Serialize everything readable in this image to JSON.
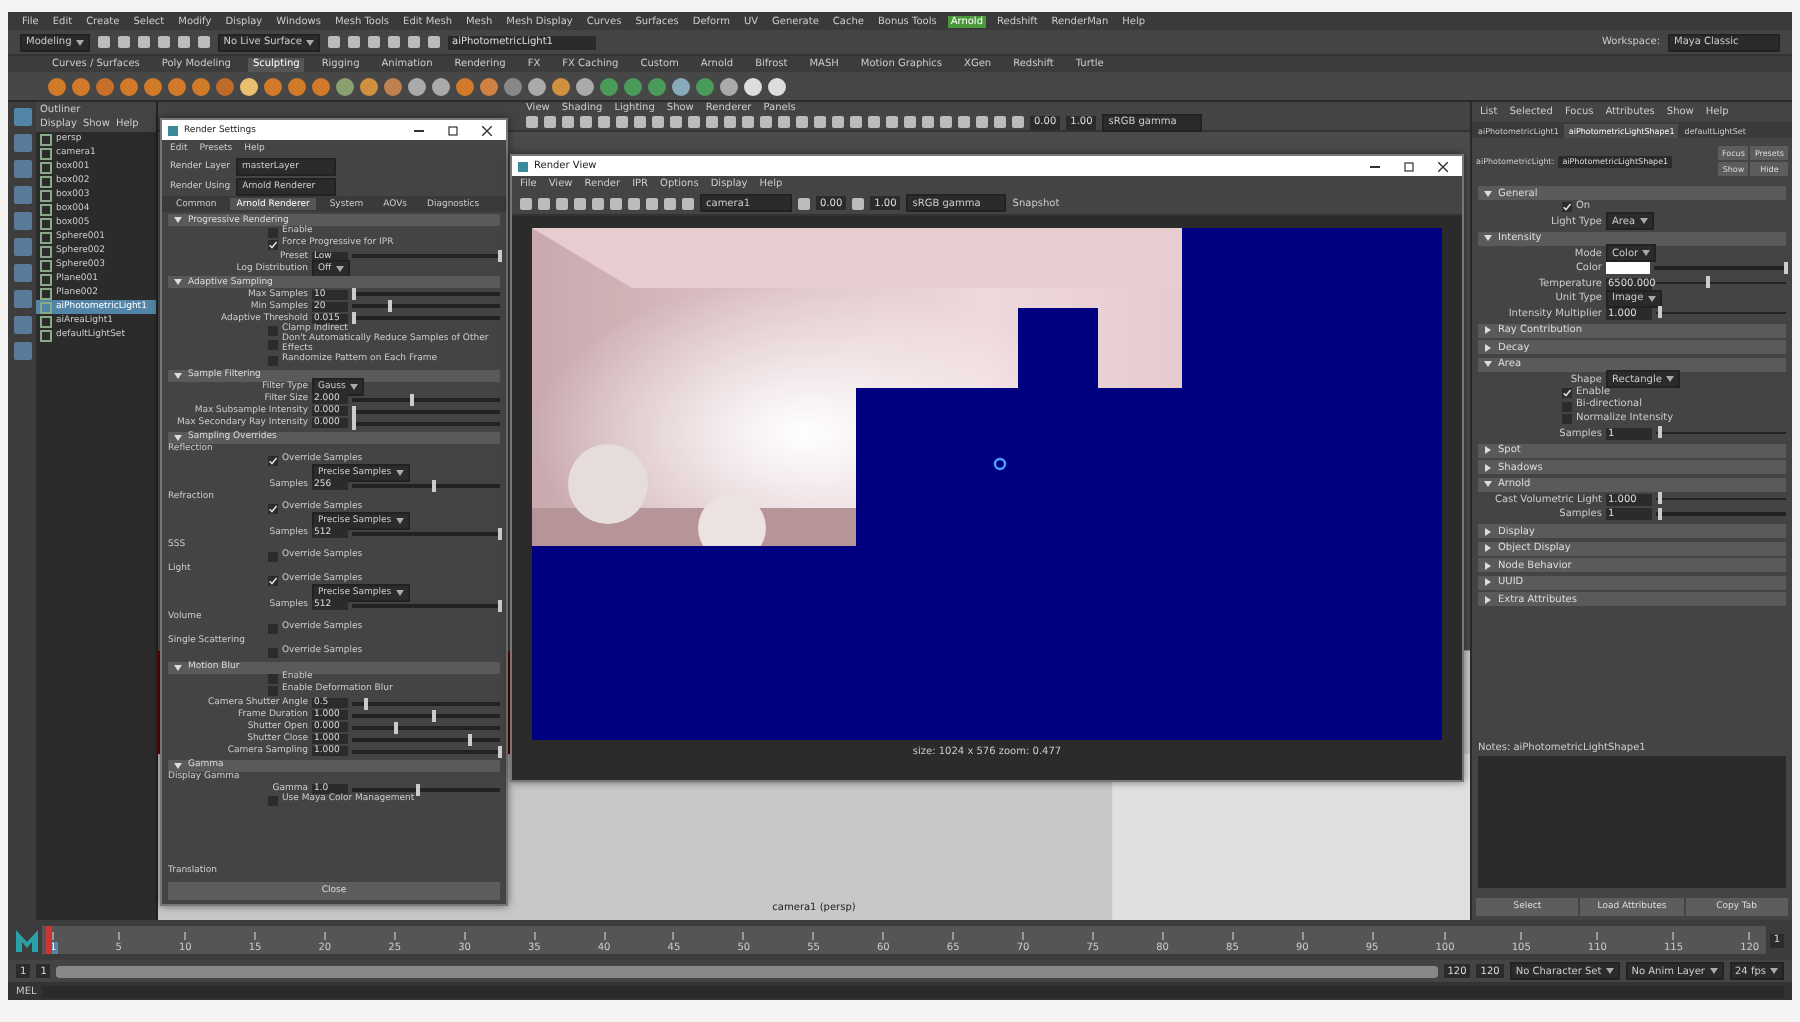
{
  "menubar": [
    {
      "label": "File",
      "selected": false
    },
    {
      "label": "Edit",
      "selected": false
    },
    {
      "label": "Create",
      "selected": false
    },
    {
      "label": "Select",
      "selected": false
    },
    {
      "label": "Modify",
      "selected": false
    },
    {
      "label": "Display",
      "selected": false
    },
    {
      "label": "Windows",
      "selected": false
    },
    {
      "label": "Mesh Tools",
      "selected": false
    },
    {
      "label": "Edit Mesh",
      "selected": false
    },
    {
      "label": "Mesh",
      "selected": false
    },
    {
      "label": "Mesh Display",
      "selected": false
    },
    {
      "label": "Curves",
      "selected": false
    },
    {
      "label": "Surfaces",
      "selected": false
    },
    {
      "label": "Deform",
      "selected": false
    },
    {
      "label": "UV",
      "selected": false
    },
    {
      "label": "Generate",
      "selected": false
    },
    {
      "label": "Cache",
      "selected": false
    },
    {
      "label": "Bonus Tools",
      "selected": false
    },
    {
      "label": "Arnold",
      "selected": true
    },
    {
      "label": "Redshift",
      "selected": false
    },
    {
      "label": "RenderMan",
      "selected": false
    },
    {
      "label": "Help",
      "selected": false
    }
  ],
  "status_line": {
    "mode": "Modeling",
    "live_surface": "No Live Surface",
    "object_field": "aiPhotometricLight1",
    "workspace_label": "Workspace:",
    "workspace": "Maya Classic"
  },
  "shelf_tabs": [
    {
      "label": "Curves / Surfaces",
      "selected": false
    },
    {
      "label": "Poly Modeling",
      "selected": false
    },
    {
      "label": "Sculpting",
      "selected": true
    },
    {
      "label": "Rigging",
      "selected": false
    },
    {
      "label": "Animation",
      "selected": false
    },
    {
      "label": "Rendering",
      "selected": false
    },
    {
      "label": "FX",
      "selected": false
    },
    {
      "label": "FX Caching",
      "selected": false
    },
    {
      "label": "Custom",
      "selected": false
    },
    {
      "label": "Arnold",
      "selected": false
    },
    {
      "label": "Bifrost",
      "selected": false
    },
    {
      "label": "MASH",
      "selected": false
    },
    {
      "label": "Motion Graphics",
      "selected": false
    },
    {
      "label": "XGen",
      "selected": false
    },
    {
      "label": "Redshift",
      "selected": false
    },
    {
      "label": "Turtle",
      "selected": false
    }
  ],
  "outliner": {
    "title": "Outliner",
    "menu": [
      "Display",
      "Show",
      "Help"
    ],
    "items": [
      {
        "label": "persp",
        "selected": false
      },
      {
        "label": "camera1",
        "selected": false
      },
      {
        "label": "box001",
        "selected": false
      },
      {
        "label": "box002",
        "selected": false
      },
      {
        "label": "box003",
        "selected": false
      },
      {
        "label": "box004",
        "selected": false
      },
      {
        "label": "box005",
        "selected": false
      },
      {
        "label": "Sphere001",
        "selected": false
      },
      {
        "label": "Sphere002",
        "selected": false
      },
      {
        "label": "Sphere003",
        "selected": false
      },
      {
        "label": "Plane001",
        "selected": false
      },
      {
        "label": "Plane002",
        "selected": false
      },
      {
        "label": "aiPhotometricLight1",
        "selected": true
      },
      {
        "label": "aiAreaLight1",
        "selected": false
      },
      {
        "label": "defaultLightSet",
        "selected": false
      }
    ]
  },
  "viewport": {
    "menu": [
      "View",
      "Shading",
      "Lighting",
      "Show",
      "Renderer",
      "Panels"
    ],
    "gamma": "sRGB gamma",
    "exposure": "0.00",
    "gamma_value": "1.00",
    "camera_label": "camera1 (persp)"
  },
  "render_settings": {
    "title": "Render Settings",
    "menu": [
      "Edit",
      "Presets",
      "Help"
    ],
    "layer_label": "Render Layer",
    "layer": "masterLayer",
    "using_label": "Render Using",
    "using": "Arnold Renderer",
    "tabs": [
      {
        "label": "Common",
        "selected": false
      },
      {
        "label": "Arnold Renderer",
        "selected": true
      },
      {
        "label": "System",
        "selected": false
      },
      {
        "label": "AOVs",
        "selected": false
      },
      {
        "label": "Diagnostics",
        "selected": false
      }
    ],
    "rows": [
      {
        "kind": "section",
        "title": "Progressive Rendering",
        "expanded": true
      },
      {
        "kind": "check",
        "text": "Enable",
        "checked": false
      },
      {
        "kind": "check",
        "text": "Force Progressive for IPR",
        "checked": true
      },
      {
        "kind": "slider",
        "label": "Preset",
        "value": "Low",
        "level": 1
      },
      {
        "kind": "dropdown",
        "label": "Log Distribution",
        "value": "Off"
      },
      {
        "kind": "section",
        "title": "Adaptive Sampling",
        "expanded": true
      },
      {
        "kind": "slider",
        "label": "Max Samples",
        "value": "10",
        "level": 0.02
      },
      {
        "kind": "slider",
        "label": "Min Samples",
        "value": "20",
        "level": 0.25
      },
      {
        "kind": "slider",
        "label": "Adaptive Threshold",
        "value": "0.015",
        "level": 0.02
      },
      {
        "kind": "check",
        "text": "Clamp Indirect",
        "checked": false
      },
      {
        "kind": "check",
        "text": "Don't Automatically Reduce Samples of Other Effects",
        "checked": false
      },
      {
        "kind": "check",
        "text": "Randomize Pattern on Each Frame",
        "checked": false
      },
      {
        "kind": "section",
        "title": "Sample Filtering",
        "expanded": true
      },
      {
        "kind": "dropdown",
        "label": "Filter Type",
        "value": "Gauss"
      },
      {
        "kind": "slider",
        "label": "Filter Size",
        "value": "2.000",
        "level": 0.4
      },
      {
        "kind": "slider",
        "label": "Max Subsample Intensity",
        "value": "0.000",
        "level": 0.02
      },
      {
        "kind": "slider",
        "label": "Max Secondary Ray Intensity",
        "value": "0.000",
        "level": 0.02
      },
      {
        "kind": "section",
        "title": "Sampling Overrides",
        "expanded": true
      },
      {
        "kind": "caption",
        "text": "Reflection"
      },
      {
        "kind": "check",
        "text": "Override Samples",
        "checked": true
      },
      {
        "kind": "dropdown",
        "label": "",
        "value": "Precise Samples"
      },
      {
        "kind": "slider",
        "label": "Samples",
        "value": "256",
        "level": 0.55
      },
      {
        "kind": "caption",
        "text": "Refraction"
      },
      {
        "kind": "check",
        "text": "Override Samples",
        "checked": true
      },
      {
        "kind": "dropdown",
        "label": "",
        "value": "Precise Samples"
      },
      {
        "kind": "slider",
        "label": "Samples",
        "value": "512",
        "level": 1
      },
      {
        "kind": "caption",
        "text": "SSS"
      },
      {
        "kind": "check",
        "text": "Override Samples",
        "checked": false
      },
      {
        "kind": "caption",
        "text": "Light"
      },
      {
        "kind": "check",
        "text": "Override Samples",
        "checked": true
      },
      {
        "kind": "dropdown",
        "label": "",
        "value": "Precise Samples"
      },
      {
        "kind": "slider",
        "label": "Samples",
        "value": "512",
        "level": 1
      },
      {
        "kind": "caption",
        "text": "Volume"
      },
      {
        "kind": "check",
        "text": "Override Samples",
        "checked": false
      },
      {
        "kind": "caption",
        "text": "Single Scattering"
      },
      {
        "kind": "check",
        "text": "Override Samples",
        "checked": false
      },
      {
        "kind": "section",
        "title": "Motion Blur",
        "expanded": true
      },
      {
        "kind": "check",
        "text": "Enable",
        "checked": false
      },
      {
        "kind": "check",
        "text": "Enable Deformation Blur",
        "checked": false
      },
      {
        "kind": "slider",
        "label": "Camera Shutter Angle",
        "value": "0.5",
        "level": 0.1
      },
      {
        "kind": "slider",
        "label": "Frame Duration",
        "value": "1.000",
        "level": 0.55
      },
      {
        "kind": "slider",
        "label": "Shutter Open",
        "value": "0.000",
        "level": 0.3
      },
      {
        "kind": "slider",
        "label": "Shutter Close",
        "value": "1.000",
        "level": 0.8
      },
      {
        "kind": "slider",
        "label": "Camera Sampling",
        "value": "1.000",
        "level": 1
      },
      {
        "kind": "section",
        "title": "Gamma",
        "expanded": true
      },
      {
        "kind": "caption",
        "text": "Display Gamma"
      },
      {
        "kind": "slider",
        "label": "Gamma",
        "value": "1.0",
        "level": 0.45
      },
      {
        "kind": "check",
        "text": "Use Maya Color Management",
        "checked": false
      }
    ],
    "footer_label": "Translation",
    "close": "Close"
  },
  "render_view": {
    "title": "Render View",
    "menu": [
      "File",
      "View",
      "Render",
      "IPR",
      "Options",
      "Display",
      "Help"
    ],
    "camera": "camera1",
    "exposure": "0.00",
    "gamma": "1.00",
    "color_space": "sRGB gamma",
    "snapshot": "Snapshot",
    "status": "size: 1024 x 576  zoom: 0.477"
  },
  "attribute_editor": {
    "menu": [
      "List",
      "Selected",
      "Focus",
      "Attributes",
      "Show",
      "Help"
    ],
    "tabs": [
      {
        "label": "aiPhotometricLight1",
        "selected": false
      },
      {
        "label": "aiPhotometricLightShape1",
        "selected": true
      },
      {
        "label": "defaultLightSet",
        "selected": false
      }
    ],
    "node_label": "aiPhotometricLight:",
    "node_value": "aiPhotometricLightShape1",
    "buttons": [
      "Focus",
      "Presets",
      "Show",
      "Hide"
    ],
    "rows": [
      {
        "kind": "section",
        "title": "General",
        "expanded": true
      },
      {
        "kind": "check",
        "text": "On",
        "checked": true
      },
      {
        "kind": "dropdown",
        "label": "Light Type",
        "value": "Area"
      },
      {
        "kind": "section",
        "title": "Intensity",
        "expanded": true
      },
      {
        "kind": "dropdown",
        "label": "Mode",
        "value": "Color"
      },
      {
        "kind": "color",
        "label": "Color",
        "level": 1
      },
      {
        "kind": "slider",
        "label": "Temperature",
        "value": "6500.000",
        "level": 0.4
      },
      {
        "kind": "dropdown",
        "label": "Unit Type",
        "value": "Image"
      },
      {
        "kind": "slider",
        "label": "Intensity Multiplier",
        "value": "1.000",
        "level": 0.03
      },
      {
        "kind": "section",
        "title": "Ray Contribution",
        "expanded": false
      },
      {
        "kind": "section",
        "title": "Decay",
        "expanded": false
      },
      {
        "kind": "section",
        "title": "Area",
        "expanded": true
      },
      {
        "kind": "dropdown",
        "label": "Shape",
        "value": "Rectangle"
      },
      {
        "kind": "check",
        "text": "Enable",
        "checked": true
      },
      {
        "kind": "check",
        "text": "Bi-directional",
        "checked": false
      },
      {
        "kind": "check",
        "text": "Normalize Intensity",
        "checked": false
      },
      {
        "kind": "slider",
        "label": "Samples",
        "value": "1",
        "level": 0.03
      },
      {
        "kind": "section",
        "title": "Spot",
        "expanded": false
      },
      {
        "kind": "section",
        "title": "Shadows",
        "expanded": false
      },
      {
        "kind": "section",
        "title": "Arnold",
        "expanded": true
      },
      {
        "kind": "slider",
        "label": "Cast Volumetric Light",
        "value": "1.000",
        "level": 0.03
      },
      {
        "kind": "slider",
        "label": "Samples",
        "value": "1",
        "level": 0.03
      },
      {
        "kind": "section",
        "title": "Display",
        "expanded": false
      },
      {
        "kind": "section",
        "title": "Object Display",
        "expanded": false
      },
      {
        "kind": "section",
        "title": "Node Behavior",
        "expanded": false
      },
      {
        "kind": "section",
        "title": "UUID",
        "expanded": false
      },
      {
        "kind": "section",
        "title": "Extra Attributes",
        "expanded": false
      }
    ],
    "notes_label": "Notes: aiPhotometricLightShape1",
    "bottom_buttons": [
      "Select",
      "Load Attributes",
      "Copy Tab"
    ]
  },
  "time_slider": {
    "ticks": [
      "1",
      "5",
      "10",
      "15",
      "20",
      "25",
      "30",
      "35",
      "40",
      "45",
      "50",
      "55",
      "60",
      "65",
      "70",
      "75",
      "80",
      "85",
      "90",
      "95",
      "100",
      "105",
      "110",
      "115",
      "120"
    ],
    "current": "1",
    "level": 0
  },
  "range_slider": {
    "level": 1,
    "start": "1",
    "range_start": "1",
    "range_end": "120",
    "end": "120",
    "character_set": "No Character Set",
    "anim_layer": "No Anim Layer",
    "fps": "24 fps"
  },
  "command_line": {
    "label": "MEL"
  }
}
